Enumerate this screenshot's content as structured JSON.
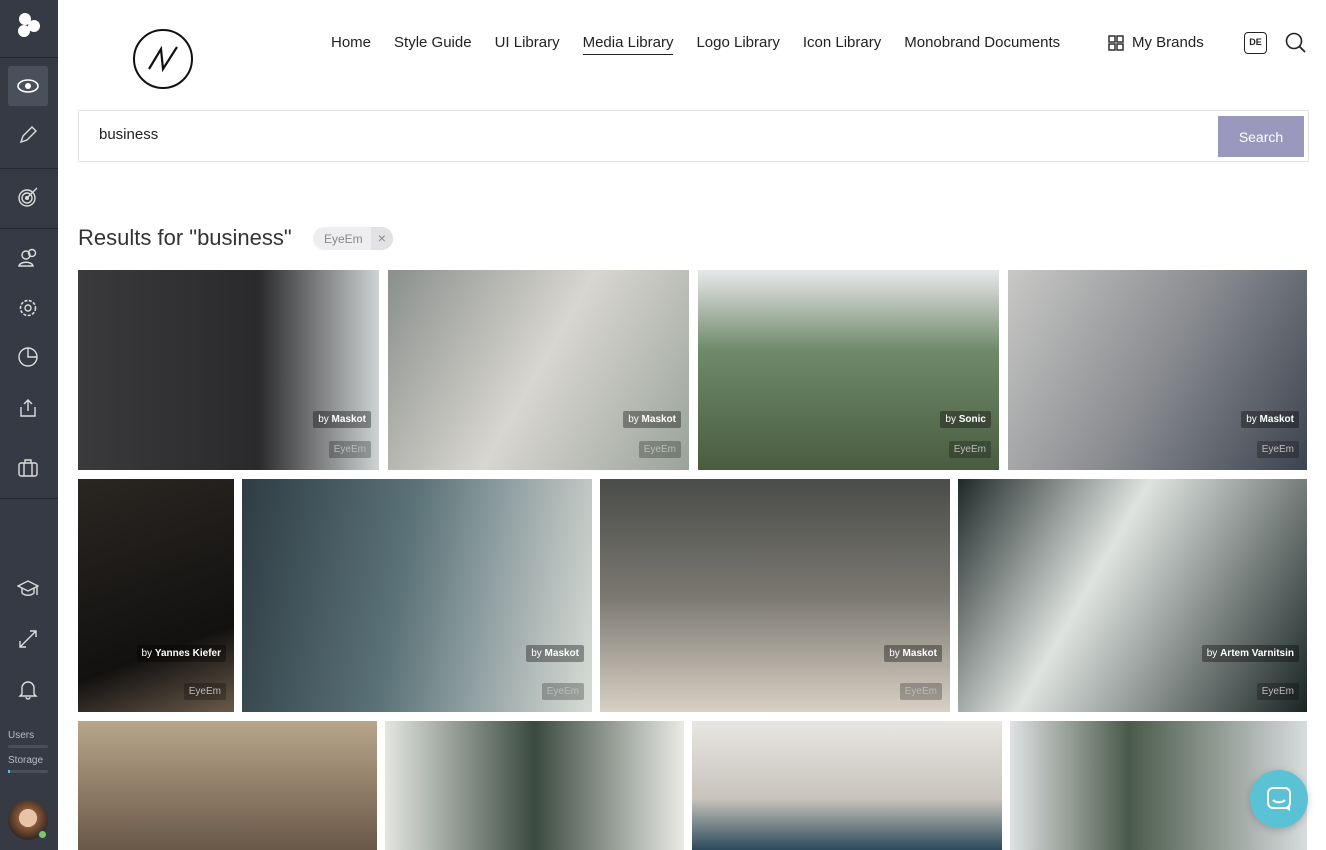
{
  "sidebar": {
    "items": [
      "eye-icon",
      "pencil-icon",
      "target-icon",
      "users-icon",
      "gear-icon",
      "pie-chart-icon",
      "upload-icon",
      "briefcase-icon",
      "graduation-cap-icon",
      "expand-icon",
      "bell-icon"
    ],
    "users_label": "Users",
    "storage_label": "Storage",
    "storage_fraction": 0.05
  },
  "nav": {
    "items": [
      "Home",
      "Style Guide",
      "UI Library",
      "Media Library",
      "Logo Library",
      "Icon Library",
      "Monobrand Documents"
    ],
    "active": "Media Library",
    "brands": "My Brands",
    "lang": "DE"
  },
  "search": {
    "value": "business",
    "button": "Search"
  },
  "results": {
    "title": "Results for \"business\"",
    "filter": "EyeEm"
  },
  "colors": {
    "sidebar": "#353a44",
    "search_button": "#9a98bd",
    "chat": "#5bc2d6"
  },
  "images": [
    {
      "author": "Maskot",
      "source": "EyeEm",
      "bg": "linear-gradient(90deg,#3a3a3c,#2a2a2c 60%,#cfd3d4)"
    },
    {
      "author": "Maskot",
      "source": "EyeEm",
      "bg": "linear-gradient(120deg,#8a8f8c,#d8d6d0 50%,#9aa39a)"
    },
    {
      "author": "Sonic",
      "source": "EyeEm",
      "bg": "linear-gradient(180deg,#e8e8ea,#6f8a6a 40%,#4a5c40)"
    },
    {
      "author": "Maskot",
      "source": "EyeEm",
      "bg": "linear-gradient(120deg,#c8c8c6,#8a8c90 50%,#3c4450)"
    },
    {
      "author": "Yannes Kiefer",
      "source": "EyeEm",
      "bg": "linear-gradient(160deg,#2a2622,#121110 70%,#6a5a4a)"
    },
    {
      "author": "Maskot",
      "source": "EyeEm",
      "bg": "linear-gradient(100deg,#2f3c44,#5a7278 45%,#d8dcd6)"
    },
    {
      "author": "Maskot",
      "source": "EyeEm",
      "bg": "linear-gradient(180deg,#4a4c4a,#7a7870 50%,#d8d0c4)"
    },
    {
      "author": "Artem Varnitsin",
      "source": "EyeEm",
      "bg": "linear-gradient(120deg,#1e2a28,#dfe3e0 40%,#1a2624)"
    },
    {
      "author": "",
      "source": "",
      "bg": "linear-gradient(180deg,#b8a68a,#6a5848)"
    },
    {
      "author": "",
      "source": "",
      "bg": "linear-gradient(90deg,#e4e6e2,#3a4a40 50%,#eaeae6)"
    },
    {
      "author": "",
      "source": "",
      "bg": "linear-gradient(180deg,#e8e6e2,#c8c4bc 60%,#2c4a5c)"
    },
    {
      "author": "",
      "source": "",
      "bg": "linear-gradient(90deg,#e0e2e4,#4a5a4a 40%,#d8dcde)"
    }
  ]
}
